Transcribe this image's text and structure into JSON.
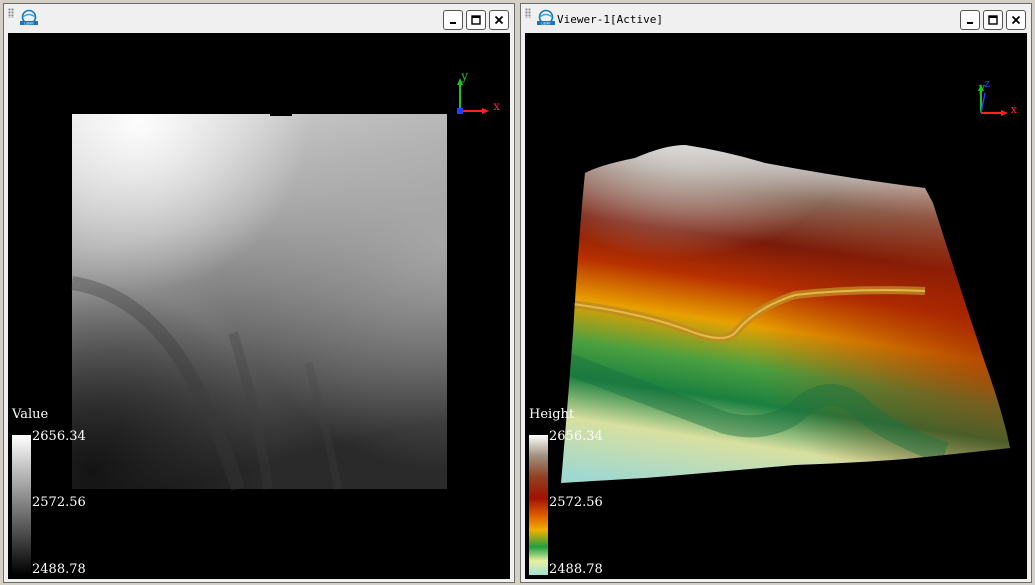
{
  "viewer_left": {
    "title": "",
    "legend": {
      "title": "Value",
      "max": "2656.34",
      "mid": "2572.56",
      "min": "2488.78"
    },
    "axis": {
      "x": "x",
      "y": "y"
    }
  },
  "viewer_right": {
    "title": "Viewer-1[Active]",
    "legend": {
      "title": "Height",
      "max": "2656.34",
      "mid": "2572.56",
      "min": "2488.78"
    },
    "axis": {
      "x": "x",
      "y": "y",
      "z": "z"
    }
  },
  "colors": {
    "background": "#000000",
    "axis_x": "#ff2020",
    "axis_y": "#20c020",
    "axis_z": "#2040ff",
    "height_ramp": [
      "#a0e0d8",
      "#e8f0a0",
      "#20a040",
      "#f0a000",
      "#a01000",
      "#904020",
      "#ffffff"
    ]
  },
  "icons": {
    "logo": "lidar-logo-icon",
    "minimize": "minimize-icon",
    "maximize": "maximize-icon",
    "close": "close-icon"
  }
}
